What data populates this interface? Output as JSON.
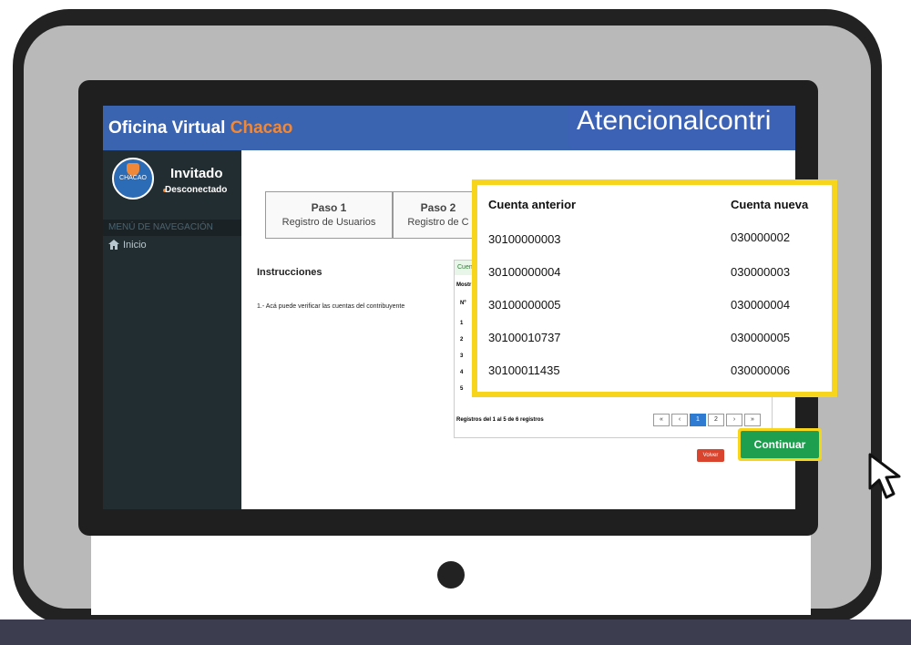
{
  "brand": {
    "part1": "Oficina Virtual ",
    "part2": "Chacao"
  },
  "banner_text": "Atencionalcontri",
  "user": {
    "avatar_text": "CHACAO",
    "name": "Invitado",
    "status": "Desconectado"
  },
  "nav": {
    "header": "MENÚ DE NAVEGACIÓN",
    "home": "Inicio"
  },
  "steps": [
    {
      "title": "Paso 1",
      "subtitle": "Registro de Usuarios"
    },
    {
      "title": "Paso 2",
      "subtitle": "Registro de C"
    }
  ],
  "instructions": {
    "title": "Instrucciones",
    "item": "1.-  Acá puede verificar las cuentas del contribuyente"
  },
  "panel": {
    "tab": "Cuen",
    "show": "Mostr",
    "col_no": "Nº",
    "rows": [
      "1",
      "2",
      "3",
      "4",
      "5"
    ],
    "info": "Registros del 1 al 5 de 6 registros",
    "pager": [
      "«",
      "‹",
      "1",
      "2",
      "›",
      "»"
    ]
  },
  "buttons": {
    "volver": "Volver",
    "continuar": "Continuar"
  },
  "accounts": {
    "header_old": "Cuenta anterior",
    "header_new": "Cuenta nueva",
    "rows": [
      {
        "old": "30100000003",
        "new": "030000002"
      },
      {
        "old": "30100000004",
        "new": "030000003"
      },
      {
        "old": "30100000005",
        "new": "030000004"
      },
      {
        "old": "30100010737",
        "new": "030000005"
      },
      {
        "old": "30100011435",
        "new": "030000006"
      }
    ]
  },
  "colors": {
    "header_blue": "#3a63b0",
    "brand_orange": "#f0883a",
    "sidebar_dark": "#222d32",
    "highlight_yellow": "#f7d51c",
    "continue_green": "#1e9e4f",
    "volver_red": "#d9442f"
  },
  "icons": [
    "home-icon",
    "cursor-arrow-icon",
    "shield-logo-icon"
  ]
}
